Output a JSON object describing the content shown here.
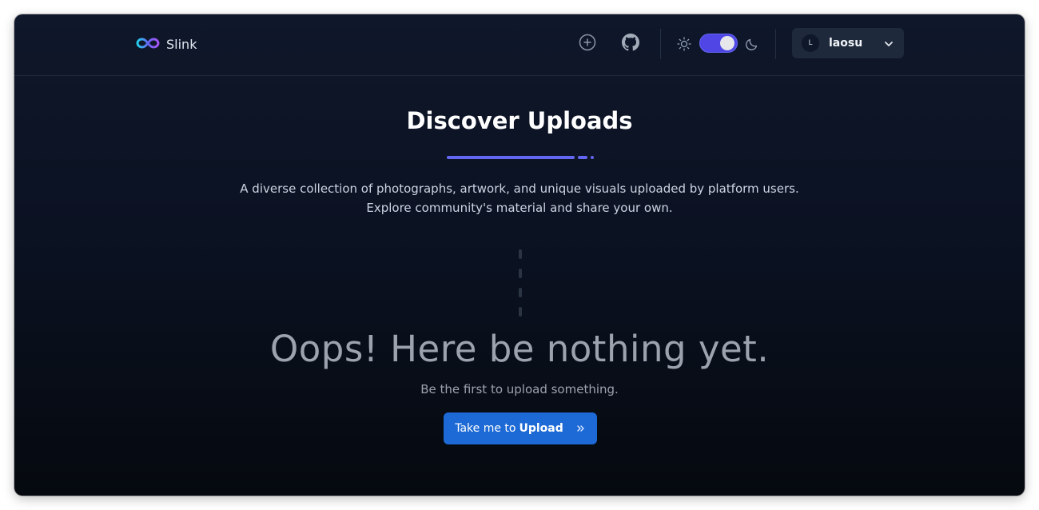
{
  "navbar": {
    "brand_name": "Slink",
    "username": "laosu",
    "avatar_initial": "L",
    "icons": {
      "logo": "infinity-logo-icon",
      "upload": "plus-circle-icon",
      "github": "github-icon",
      "theme_light": "sun-icon",
      "theme_dark": "moon-icon",
      "menu": "chevron-down-icon"
    },
    "theme_dark_enabled": true
  },
  "hero": {
    "title": "Discover Uploads",
    "description": "A diverse collection of photographs, artwork, and unique visuals uploaded by platform users. Explore community's material and share your own."
  },
  "empty_state": {
    "title": "Oops! Here be nothing yet.",
    "subtitle": "Be the first to upload something.",
    "button_prefix": "Take me to",
    "button_strong": "Upload",
    "button_icon": "chevrons-right-icon"
  },
  "colors": {
    "accent": "#6366f1",
    "button": "#1d6ad6",
    "background": "#0b1222"
  }
}
